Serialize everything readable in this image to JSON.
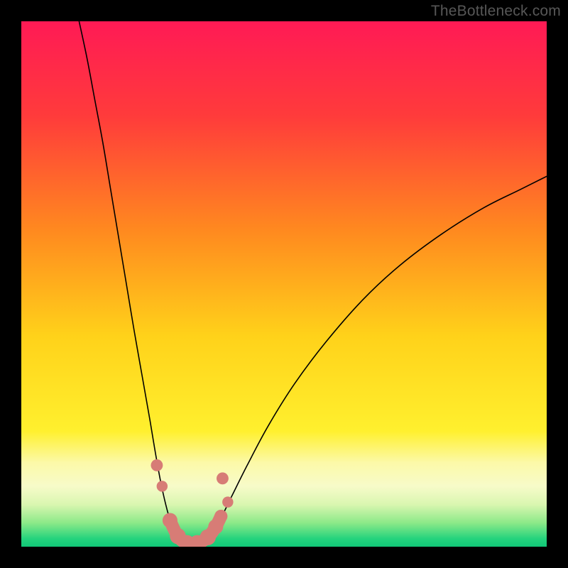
{
  "watermark": "TheBottleneck.com",
  "chart_data": {
    "type": "line",
    "title": "",
    "xlabel": "",
    "ylabel": "",
    "xlim": [
      0,
      100
    ],
    "ylim": [
      0,
      100
    ],
    "background_gradient": {
      "stops": [
        {
          "offset": 0.0,
          "color": "#ff1a55"
        },
        {
          "offset": 0.18,
          "color": "#ff3b3b"
        },
        {
          "offset": 0.4,
          "color": "#ff8a1f"
        },
        {
          "offset": 0.6,
          "color": "#ffd21a"
        },
        {
          "offset": 0.78,
          "color": "#fff02e"
        },
        {
          "offset": 0.84,
          "color": "#fcf9a8"
        },
        {
          "offset": 0.885,
          "color": "#f7fbc9"
        },
        {
          "offset": 0.92,
          "color": "#d9f6b0"
        },
        {
          "offset": 0.955,
          "color": "#8be988"
        },
        {
          "offset": 0.985,
          "color": "#24d37d"
        },
        {
          "offset": 1.0,
          "color": "#11c777"
        }
      ]
    },
    "series": [
      {
        "name": "left-arm",
        "stroke": "#000000",
        "points": [
          {
            "x": 11.0,
            "y": 100.0
          },
          {
            "x": 12.5,
            "y": 93.0
          },
          {
            "x": 14.0,
            "y": 85.0
          },
          {
            "x": 15.5,
            "y": 77.0
          },
          {
            "x": 17.0,
            "y": 68.0
          },
          {
            "x": 18.5,
            "y": 59.0
          },
          {
            "x": 20.0,
            "y": 50.0
          },
          {
            "x": 21.5,
            "y": 41.0
          },
          {
            "x": 23.0,
            "y": 32.5
          },
          {
            "x": 24.5,
            "y": 24.0
          },
          {
            "x": 25.5,
            "y": 18.0
          },
          {
            "x": 26.5,
            "y": 12.5
          },
          {
            "x": 27.5,
            "y": 8.0
          },
          {
            "x": 28.5,
            "y": 4.5
          },
          {
            "x": 29.5,
            "y": 2.3
          },
          {
            "x": 30.5,
            "y": 1.0
          },
          {
            "x": 31.5,
            "y": 0.4
          },
          {
            "x": 32.5,
            "y": 0.3
          }
        ]
      },
      {
        "name": "right-arm",
        "stroke": "#000000",
        "points": [
          {
            "x": 32.5,
            "y": 0.3
          },
          {
            "x": 33.5,
            "y": 0.4
          },
          {
            "x": 34.5,
            "y": 0.9
          },
          {
            "x": 36.0,
            "y": 2.4
          },
          {
            "x": 38.0,
            "y": 5.5
          },
          {
            "x": 40.0,
            "y": 9.5
          },
          {
            "x": 43.0,
            "y": 15.5
          },
          {
            "x": 47.0,
            "y": 23.0
          },
          {
            "x": 52.0,
            "y": 31.0
          },
          {
            "x": 58.0,
            "y": 39.0
          },
          {
            "x": 65.0,
            "y": 47.0
          },
          {
            "x": 72.0,
            "y": 53.5
          },
          {
            "x": 80.0,
            "y": 59.5
          },
          {
            "x": 88.0,
            "y": 64.5
          },
          {
            "x": 95.0,
            "y": 68.0
          },
          {
            "x": 100.0,
            "y": 70.5
          }
        ]
      }
    ],
    "marker_series": {
      "name": "bottom-markers",
      "color": "#d77c76",
      "points": [
        {
          "x": 25.8,
          "y": 15.5,
          "r": 1.2
        },
        {
          "x": 26.8,
          "y": 11.5,
          "r": 1.1
        },
        {
          "x": 28.3,
          "y": 5.0,
          "r": 1.5
        },
        {
          "x": 29.8,
          "y": 2.0,
          "r": 1.6
        },
        {
          "x": 31.5,
          "y": 0.7,
          "r": 1.6
        },
        {
          "x": 33.5,
          "y": 0.7,
          "r": 1.6
        },
        {
          "x": 35.5,
          "y": 1.8,
          "r": 1.6
        },
        {
          "x": 37.0,
          "y": 3.8,
          "r": 1.5
        },
        {
          "x": 38.0,
          "y": 5.8,
          "r": 1.3
        },
        {
          "x": 38.3,
          "y": 13.0,
          "r": 1.2
        },
        {
          "x": 39.3,
          "y": 8.5,
          "r": 1.1
        }
      ]
    }
  }
}
